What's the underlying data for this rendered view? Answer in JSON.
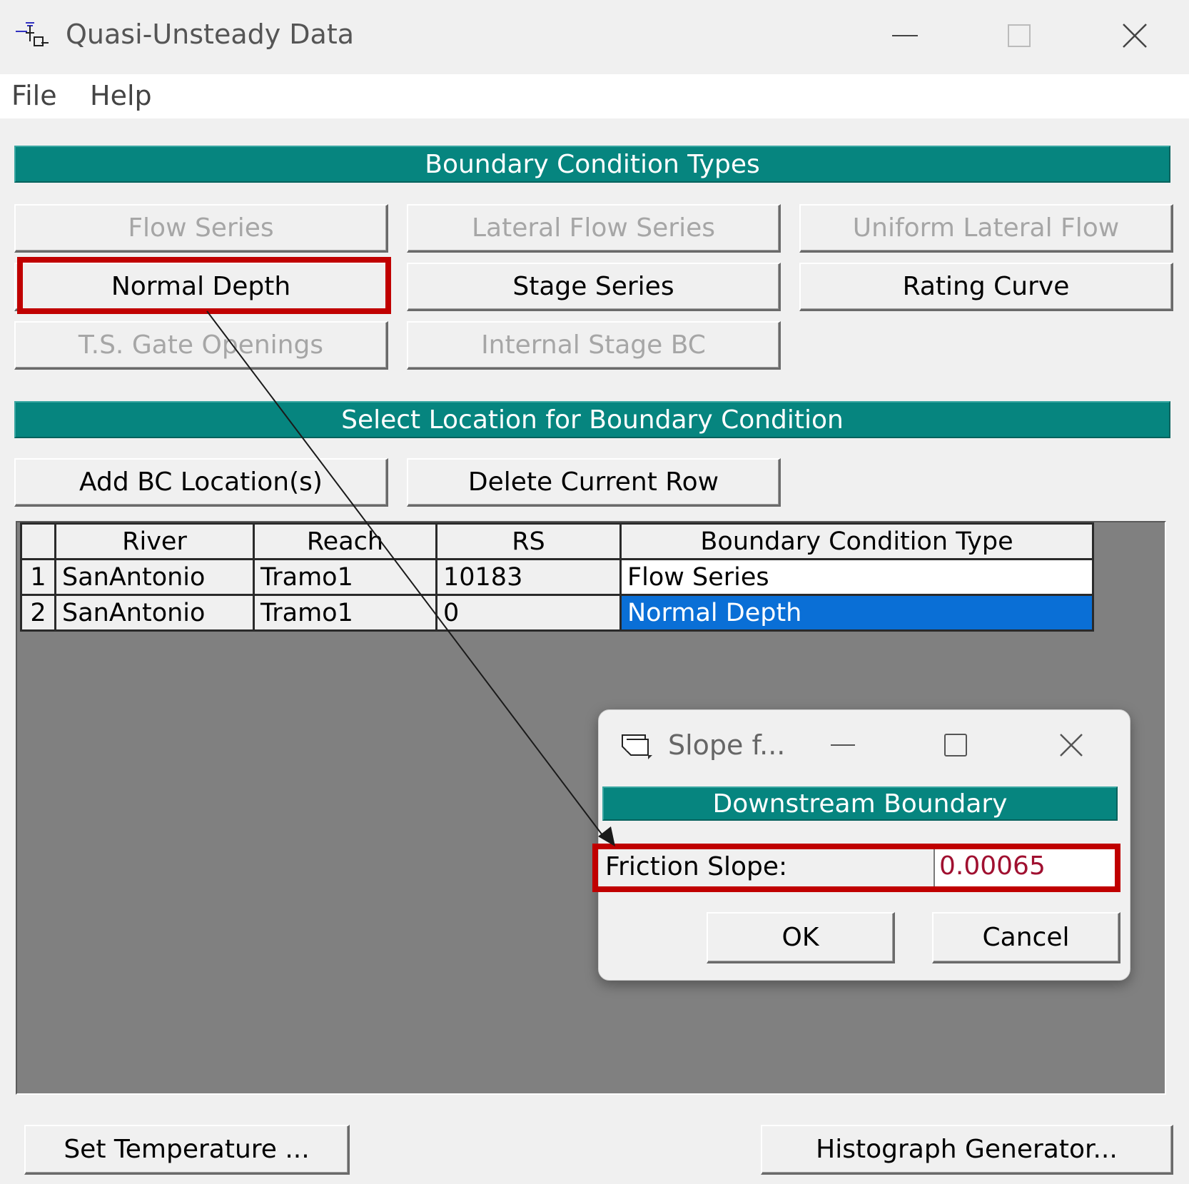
{
  "window": {
    "title": "Quasi-Unsteady Data"
  },
  "menu": {
    "items": [
      "File",
      "Help"
    ]
  },
  "bc_types": {
    "header": "Boundary Condition Types",
    "buttons": [
      {
        "label": "Flow Series",
        "enabled": false
      },
      {
        "label": "Lateral Flow Series",
        "enabled": false
      },
      {
        "label": "Uniform Lateral Flow",
        "enabled": false
      },
      {
        "label": "Normal Depth",
        "enabled": true,
        "highlighted": true
      },
      {
        "label": "Stage Series",
        "enabled": true
      },
      {
        "label": "Rating Curve",
        "enabled": true
      },
      {
        "label": "T.S. Gate Openings",
        "enabled": false
      },
      {
        "label": "Internal Stage BC",
        "enabled": false
      }
    ]
  },
  "location": {
    "header": "Select Location for Boundary Condition",
    "add_button": "Add BC Location(s)",
    "delete_button": "Delete Current Row"
  },
  "table": {
    "columns": [
      "River",
      "Reach",
      "RS",
      "Boundary Condition Type"
    ],
    "rows": [
      {
        "num": "1",
        "river": "SanAntonio",
        "reach": "Tramo1",
        "rs": "10183",
        "bc_type": "Flow Series"
      },
      {
        "num": "2",
        "river": "SanAntonio",
        "reach": "Tramo1",
        "rs": "0",
        "bc_type": "Normal Depth",
        "selected": true
      }
    ]
  },
  "bottom": {
    "temperature_button": "Set Temperature ...",
    "histograph_button": "Histograph Generator..."
  },
  "dialog": {
    "title": "Slope f...",
    "header": "Downstream Boundary",
    "friction_label": "Friction Slope:",
    "friction_value": "0.00065",
    "ok_label": "OK",
    "cancel_label": "Cancel"
  },
  "colors": {
    "header_bg": "#06857f",
    "selection": "#0a6fd6",
    "highlight_box": "#c00000"
  }
}
